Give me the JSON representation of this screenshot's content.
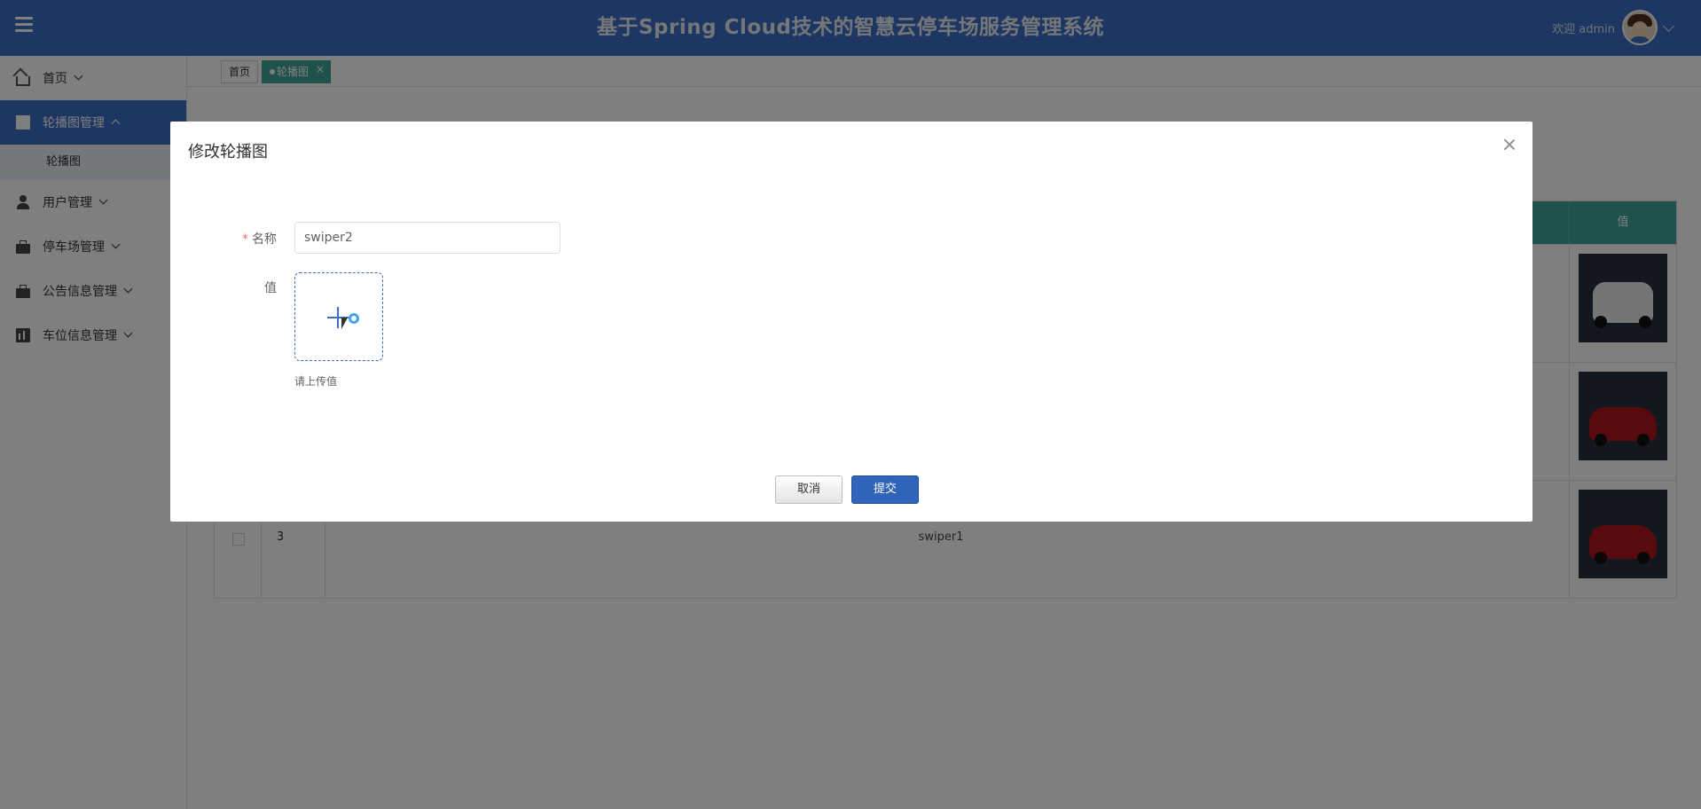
{
  "header": {
    "title": "基于Spring Cloud技术的智慧云停车场服务管理系统",
    "welcome": "欢迎 admin"
  },
  "sidebar": {
    "items": [
      {
        "label": "首页",
        "icon": "home-icon"
      },
      {
        "label": "轮播图管理",
        "icon": "book-icon",
        "active": true
      },
      {
        "label": "用户管理",
        "icon": "user-icon"
      },
      {
        "label": "停车场管理",
        "icon": "box-icon"
      },
      {
        "label": "公告信息管理",
        "icon": "box-icon"
      },
      {
        "label": "车位信息管理",
        "icon": "chart-icon"
      }
    ],
    "sub_item": "轮播图"
  },
  "tabs": {
    "home": "首页",
    "current": "轮播图",
    "close": "×"
  },
  "table": {
    "value_header": "值",
    "rows": [
      {
        "index": "",
        "name": ""
      },
      {
        "index": "",
        "name": ""
      },
      {
        "index": "3",
        "name": "swiper1"
      }
    ]
  },
  "dialog": {
    "title": "修改轮播图",
    "name_label": "名称",
    "name_value": "swiper2",
    "value_label": "值",
    "upload_tip": "请上传值",
    "cancel": "取消",
    "submit": "提交"
  },
  "colors": {
    "primary": "#3a6fc4",
    "teal": "#3ea39a",
    "required": "#f56c6c"
  }
}
